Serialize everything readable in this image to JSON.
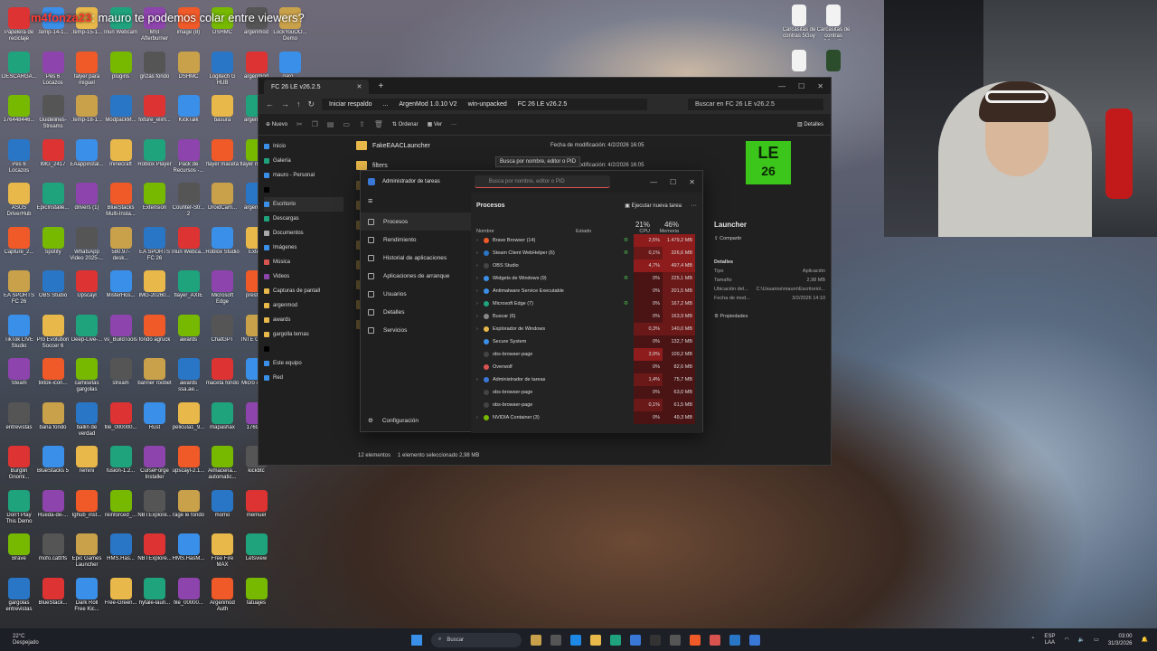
{
  "stream_overlay": {
    "name": "m4fonza23",
    "message": "mauro te podemos colar entre viewers?"
  },
  "desktop_icons": [
    [
      "Papelera de reciclaje",
      ".temp-14-1...",
      ".temp-15-1...",
      "Iriun Webcam",
      "MSI Afterburner",
      "image (8)",
      "DSHMC",
      "argenmod",
      "LockYouOO... Demo"
    ],
    [
      "DESCARGA...",
      "Pes 6 Locazos",
      "falyer para miguel",
      "plugins",
      "grizas fondo",
      "DSHMC",
      "Logitech G HUB",
      "argenmod",
      "garg..."
    ],
    [
      "176448446...",
      "Guidelines-Streams",
      ".temp-18-1...",
      "ModpackM...",
      "fixture_elim...",
      "KickTalk",
      "basura",
      "argenmod",
      "garg..."
    ],
    [
      "Pes 6 Locazos",
      "IMG_2417",
      "EAappinstal...",
      "minecraft",
      "Roblox Player",
      "Pack de Recursos -...",
      "flayer maceta",
      "flayer maceta",
      "garg..."
    ],
    [
      "ASUS DriverHub",
      "EpicInstalle...",
      "drivers (1)",
      "BlueStacks Multi-Insta...",
      "Extension",
      "Counter-Str... 2",
      "DroidCam...",
      "argenmod",
      "fidel..."
    ],
    [
      "Capture_2...",
      "Spotify",
      "WhatsApp Video 2025-...",
      "580.97-desk...",
      "EA SPORTS FC 26",
      "Iriun Webca...",
      "Roblox Studio",
      "Exte..."
    ],
    [
      "EA SPORTS FC 26",
      "OBS Studio",
      "Upscayl",
      "MisterHos...",
      "IMG-20260...",
      "flayer_AXIE",
      "Microsoft Edge",
      "prestig..."
    ],
    [
      "TikTok LIVE Studio",
      "Pro Evolution Soccer 6",
      "Deep-Live-...",
      "vs_BuildTools",
      "fondo agruck",
      "awards",
      "ChatGPT",
      "INTE GAR..."
    ],
    [
      "Steam",
      "tiktok-icon...",
      "camisetas gargolas",
      "stream",
      "banner roobet",
      "awards ssa.ae...",
      "maceta fondo",
      "Micro infor..."
    ],
    [
      "entrevistas",
      "bana fondo",
      "ballin de verdad",
      "file_000000...",
      "Rust",
      "pelicula1_9...",
      "mapashax",
      "17697..."
    ],
    [
      "Burglin Gnomi...",
      "BlueStacks 5",
      "remini",
      "fusion-1.2...",
      "CurseForge Installer",
      "upscayl-2.1...",
      "Almacena... automatic...",
      "kickbtc"
    ],
    [
      "Don't Play This Demo",
      "Rueda-de-...",
      "Ighub_inst...",
      "reinforced_...",
      "NBTExplore...",
      "rage le fondo",
      "momo",
      "memuel"
    ],
    [
      "Brave",
      "mofo.cattrfs",
      "Epic Games Launcher",
      "HMS.Has...",
      "NBTExplore...",
      "HMS.HasM...",
      "Free Fire MAX",
      "Letsview"
    ],
    [
      "gargolas entrevistas",
      "BlueStack...",
      "Dark Roll Free Kic...",
      "Free-Green...",
      "hytale-laun...",
      "file_00000...",
      "Argenmod Auth",
      "tatuajes"
    ]
  ],
  "right_icons": [
    "Carcasitas de contras 5Guy",
    "Carcasitas de contras 5Guy(2)",
    "",
    "",
    "",
    ""
  ],
  "explorer": {
    "tab_title": "FC 26 LE v26.2.5",
    "breadcrumb": [
      "Iniciar respaldo",
      "...",
      "ArgenMod 1.0.10 V2",
      "win-unpacked",
      "FC 26 LE v26.2.5"
    ],
    "search_placeholder": "Buscar en FC 26 LE v26.2.5",
    "toolbar": {
      "new": "Nuevo",
      "sort": "Ordenar",
      "view": "Ver",
      "more": "···",
      "details": "Detalles"
    },
    "sidebar": [
      "Inicio",
      "Galería",
      "mauro - Personal",
      "",
      "Escritorio",
      "Descargas",
      "Documentos",
      "Imágenes",
      "Música",
      "Videos",
      "Capturas de pantall",
      "argenmod",
      "awards",
      "gargolla ternas",
      "",
      "Este equipo",
      "Red"
    ],
    "files": [
      {
        "name": "FakeEAACLauncher",
        "meta": "Fecha de modificación: 4/2/2026 16:05"
      },
      {
        "name": "filters",
        "meta": "Fecha de modificación: 4/2/2026 16:05"
      }
    ],
    "status": {
      "count": "12 elementos",
      "selected": "1 elemento seleccionado  2,98 MB"
    },
    "preview": {
      "logo_line1": "LE",
      "logo_line2": "26",
      "title": "Launcher",
      "share": "Compartir",
      "details_title": "Detalles",
      "rows": [
        {
          "k": "Tipo",
          "v": "Aplicación"
        },
        {
          "k": "Tamaño",
          "v": "2,98 MB"
        },
        {
          "k": "Ubicación del...",
          "v": "C:\\Usuarios\\mauro\\Escritorio\\..."
        },
        {
          "k": "Fecha de mod...",
          "v": "3/2/2026 14:10"
        }
      ],
      "props": "Propiedades"
    },
    "tooltip": "Busca por nombre, editor o PID"
  },
  "taskmgr": {
    "title": "Administrador de tareas",
    "search_placeholder": "Busca por nombre, editor o PID",
    "nav": [
      "Procesos",
      "Rendimiento",
      "Historial de aplicaciones",
      "Aplicaciones de arranque",
      "Usuarios",
      "Detalles",
      "Servicios"
    ],
    "config": "Configuración",
    "heading": "Procesos",
    "run_task": "Ejecutar nueva tarea",
    "columns": {
      "name": "Nombre",
      "status": "Estado",
      "cpu_pct": "21%",
      "cpu": "CPU",
      "mem_pct": "46%",
      "mem": "Memoria"
    },
    "processes": [
      {
        "name": "Brave Browser (14)",
        "eco": true,
        "cpu": "2,5%",
        "mem": "1.479,2 MB",
        "expand": true,
        "color": "#f05a28"
      },
      {
        "name": "Steam Client WebHelper (6)",
        "eco": true,
        "cpu": "0,1%",
        "mem": "326,6 MB",
        "expand": true,
        "color": "#2a76c6"
      },
      {
        "name": "OBS Studio",
        "eco": false,
        "cpu": "4,7%",
        "mem": "497,4 MB",
        "expand": true,
        "color": "#444"
      },
      {
        "name": "Widgets de Windows (9)",
        "eco": true,
        "cpu": "0%",
        "mem": "225,1 MB",
        "expand": true,
        "color": "#3a8fe8"
      },
      {
        "name": "Antimalware Service Executable",
        "eco": false,
        "cpu": "0%",
        "mem": "201,5 MB",
        "expand": true,
        "color": "#3a8fe8"
      },
      {
        "name": "Microsoft Edge (7)",
        "eco": true,
        "cpu": "0%",
        "mem": "167,2 MB",
        "expand": true,
        "color": "#1fa37d"
      },
      {
        "name": "Buscar (6)",
        "eco": false,
        "cpu": "0%",
        "mem": "163,9 MB",
        "expand": true,
        "color": "#888"
      },
      {
        "name": "Explorador de Windows",
        "eco": false,
        "cpu": "0,3%",
        "mem": "140,0 MB",
        "expand": true,
        "color": "#e8b84a"
      },
      {
        "name": "Secure System",
        "eco": false,
        "cpu": "0%",
        "mem": "132,7 MB",
        "expand": false,
        "color": "#3a8fe8"
      },
      {
        "name": "obs-browser-page",
        "eco": false,
        "cpu": "3,9%",
        "mem": "109,2 MB",
        "expand": false,
        "color": "#444"
      },
      {
        "name": "Overwolf",
        "eco": false,
        "cpu": "0%",
        "mem": "82,6 MB",
        "expand": false,
        "color": "#d9534f"
      },
      {
        "name": "Administrador de tareas",
        "eco": false,
        "cpu": "1,4%",
        "mem": "75,7 MB",
        "expand": true,
        "color": "#3a78d8"
      },
      {
        "name": "obs-browser-page",
        "eco": false,
        "cpu": "0%",
        "mem": "63,0 MB",
        "expand": false,
        "color": "#444"
      },
      {
        "name": "obs-browser-page",
        "eco": false,
        "cpu": "0,1%",
        "mem": "61,5 MB",
        "expand": false,
        "color": "#444"
      },
      {
        "name": "NVIDIA Container (3)",
        "eco": false,
        "cpu": "0%",
        "mem": "49,3 MB",
        "expand": true,
        "color": "#76b900"
      }
    ]
  },
  "taskbar": {
    "weather_temp": "22°C",
    "weather_desc": "Despejado",
    "search": "Buscar",
    "lang1": "ESP",
    "lang2": "LAA",
    "time": "03:00",
    "date": "31/3/2026"
  },
  "colors": {
    "accent": "#3a8fe8",
    "cpu_hot": "#8e1c1c",
    "eco_green": "#4bb84b",
    "le_green": "#3cc51a"
  }
}
